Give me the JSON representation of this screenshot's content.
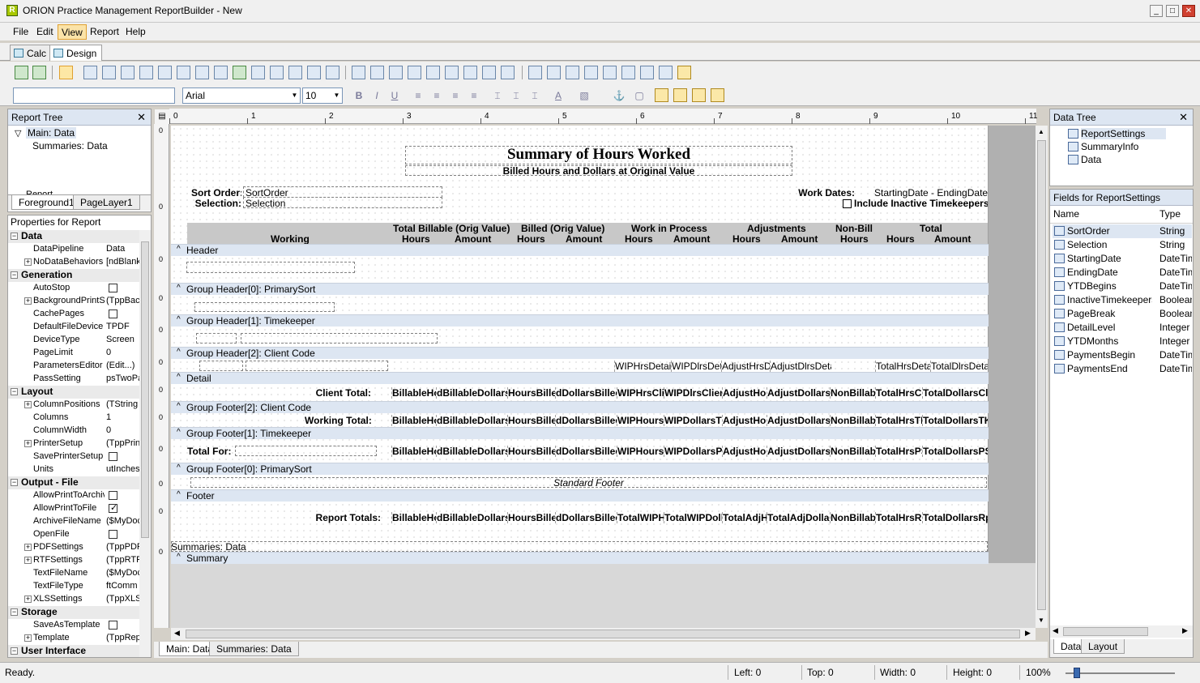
{
  "window": {
    "title": "ORION Practice Management ReportBuilder - New",
    "icon_letter": "R"
  },
  "menu": [
    "File",
    "Edit",
    "View",
    "Report",
    "Help"
  ],
  "mode_tabs": [
    "Calc",
    "Design"
  ],
  "font": {
    "name": "Arial",
    "size": "10"
  },
  "report_tree": {
    "title": "Report Tree",
    "root": "Main: Data",
    "child": "Summaries: Data",
    "partial": "Report",
    "tabs": [
      "Foreground1",
      "PageLayer1"
    ]
  },
  "properties": {
    "title": "Properties for Report",
    "rows": [
      {
        "cat": "Data"
      },
      {
        "n": "DataPipeline",
        "v": "Data"
      },
      {
        "n": "NoDataBehaviors",
        "v": "[ndBlank",
        "plus": "+"
      },
      {
        "cat": "Generation"
      },
      {
        "n": "AutoStop",
        "chk": false
      },
      {
        "n": "BackgroundPrintSe",
        "v": "(TppBac",
        "plus": "+"
      },
      {
        "n": "CachePages",
        "chk": false
      },
      {
        "n": "DefaultFileDevice",
        "v": "TPDF"
      },
      {
        "n": "DeviceType",
        "v": "Screen"
      },
      {
        "n": "PageLimit",
        "v": "0"
      },
      {
        "n": "ParametersEditor",
        "v": "(Edit...)"
      },
      {
        "n": "PassSetting",
        "v": "psTwoPa"
      },
      {
        "cat": "Layout"
      },
      {
        "n": "ColumnPositions",
        "v": "(TString",
        "plus": "+"
      },
      {
        "n": "Columns",
        "v": "1"
      },
      {
        "n": "ColumnWidth",
        "v": "0"
      },
      {
        "n": "PrinterSetup",
        "v": "(TppPrin",
        "plus": "+"
      },
      {
        "n": "SavePrinterSetup",
        "chk": false
      },
      {
        "n": "Units",
        "v": "utInches"
      },
      {
        "cat": "Output - File"
      },
      {
        "n": "AllowPrintToArchiv",
        "chk": false
      },
      {
        "n": "AllowPrintToFile",
        "chk": true
      },
      {
        "n": "ArchiveFileName",
        "v": "($MyDoc"
      },
      {
        "n": "OpenFile",
        "chk": false
      },
      {
        "n": "PDFSettings",
        "v": "(TppPDF",
        "plus": "+"
      },
      {
        "n": "RTFSettings",
        "v": "(TppRTF",
        "plus": "+"
      },
      {
        "n": "TextFileName",
        "v": "($MyDoc"
      },
      {
        "n": "TextFileType",
        "v": "ftComm"
      },
      {
        "n": "XLSSettings",
        "v": "(TppXLS",
        "plus": "+"
      },
      {
        "cat": "Storage"
      },
      {
        "n": "SaveAsTemplate",
        "chk": false
      },
      {
        "n": "Template",
        "v": "(TppRep",
        "plus": "+"
      },
      {
        "cat": "User Interface"
      }
    ]
  },
  "ruler": [
    "0",
    "1",
    "2",
    "3",
    "4",
    "5",
    "6",
    "7",
    "8",
    "9",
    "10",
    "11"
  ],
  "report": {
    "title": "Summary of Hours Worked",
    "subtitle": "Billed Hours and Dollars at Original Value",
    "sort_order_label": "Sort Order:",
    "sort_order_value": "SortOrder",
    "selection_label": "Selection:",
    "selection_value": "Selection",
    "work_dates_label": "Work Dates:",
    "work_dates_value": "StartingDate - EndingDate",
    "include_inactive": "Include Inactive Timekeepers",
    "col_groups": [
      "Total Billable (Orig Value)",
      "Billed (Orig Value)",
      "Work in Process",
      "Adjustments",
      "Non-Bill",
      "Total"
    ],
    "col_sub": [
      "Working",
      "Hours",
      "Amount",
      "Hours",
      "Amount",
      "Hours",
      "Amount",
      "Hours",
      "Amount",
      "Hours",
      "Hours",
      "Amount"
    ],
    "bands": [
      "Header",
      "Group Header[0]: PrimarySort",
      "Group Header[1]: Timekeeper",
      "Group Header[2]: Client Code",
      "Detail",
      "Group Footer[2]: Client Code",
      "Group Footer[1]: Timekeeper",
      "Group Footer[0]: PrimarySort",
      "Footer",
      "Summary"
    ],
    "detail_fields": [
      "WIPHrsDetail",
      "WIPDlrsDetail",
      "AdjustHrsDetail",
      "AdjustDlrsDetail",
      "TotalHrsDetail",
      "TotalDlrsDetail"
    ],
    "client_total_label": "Client Total:",
    "client_fields": [
      "BillableHours",
      "dBillableDollars",
      "HoursBilled",
      "dDollarsBilled",
      "WIPHrsClient",
      "WIPDlrsClient",
      "AdjustHoursCl",
      "AdjustDollarsCl",
      "NonBillableHours",
      "TotalHrsCl",
      "TotalDollarsCl"
    ],
    "working_total_label": "Working Total:",
    "tk_fields": [
      "BillableHours",
      "dBillableDollars",
      "HoursBilled",
      "dDollarsBilled",
      "WIPHoursTK",
      "WIPDollarsTK",
      "AdjustHoursTK",
      "AdjustDollarsTK",
      "NonBillableHours",
      "TotalHrsTK",
      "TotalDollarsTK"
    ],
    "total_for_label": "Total For:",
    "ps_fields": [
      "BillableHours",
      "dBillableDollars",
      "HoursBilled",
      "dDollarsBilled",
      "WIPHoursPS",
      "WIPDollarsPS",
      "AdjustHoursPS",
      "AdjustDollarsPS",
      "NonBillableHours",
      "TotalHrsPS",
      "TotalDollarsPS"
    ],
    "standard_footer": "Standard Footer",
    "report_totals_label": "Report Totals:",
    "rpt_fields": [
      "BillableHours",
      "dBillableDollars",
      "HoursBilled",
      "dDollarsBilled",
      "TotalWIPHrs",
      "TotalWIPDollars",
      "TotalAdjHrs",
      "TotalAdjDollars",
      "NonBillableHours",
      "TotalHrsRpt",
      "TotalDollarsRpt"
    ],
    "summaries_label": "Summaries: Data"
  },
  "bottom_tabs": [
    "Main: Data",
    "Summaries: Data"
  ],
  "data_tree": {
    "title": "Data Tree",
    "items": [
      "ReportSettings",
      "SummaryInfo",
      "Data"
    ]
  },
  "fields_panel": {
    "title": "Fields for ReportSettings",
    "col_name": "Name",
    "col_type": "Type",
    "rows": [
      {
        "n": "SortOrder",
        "t": "String"
      },
      {
        "n": "Selection",
        "t": "String"
      },
      {
        "n": "StartingDate",
        "t": "DateTime"
      },
      {
        "n": "EndingDate",
        "t": "DateTime"
      },
      {
        "n": "YTDBegins",
        "t": "DateTime"
      },
      {
        "n": "InactiveTimekeepers",
        "t": "Boolean"
      },
      {
        "n": "PageBreak",
        "t": "Boolean"
      },
      {
        "n": "DetailLevel",
        "t": "Integer"
      },
      {
        "n": "YTDMonths",
        "t": "Integer"
      },
      {
        "n": "PaymentsBegin",
        "t": "DateTime"
      },
      {
        "n": "PaymentsEnd",
        "t": "DateTime"
      }
    ],
    "tabs": [
      "Data",
      "Layout"
    ]
  },
  "status": {
    "ready": "Ready.",
    "left": "Left: 0",
    "top": "Top: 0",
    "width": "Width: 0",
    "height": "Height: 0",
    "zoom": "100%"
  }
}
